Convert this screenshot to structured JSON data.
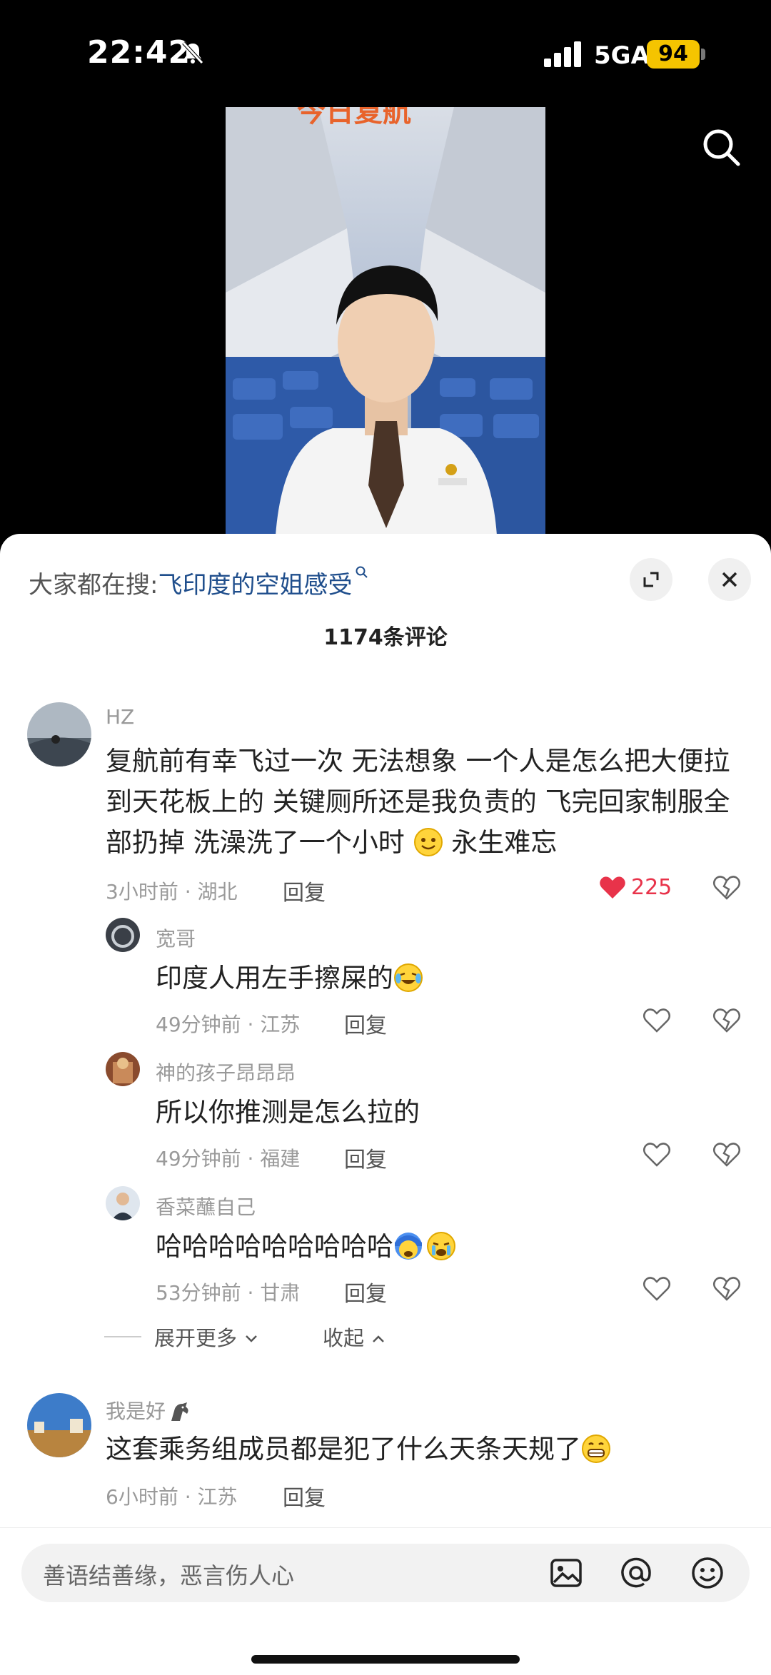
{
  "status_bar": {
    "time": "22:42",
    "network": "5GA",
    "battery": "94"
  },
  "video": {
    "banner_text": "今日复航"
  },
  "sheet": {
    "hot_search_prefix": "大家都在搜:",
    "hot_search_query": "飞印度的空姐感受",
    "comment_count": "1174条评论"
  },
  "comments": [
    {
      "user": "HZ",
      "text": "复航前有幸飞过一次 无法想象 一个人是怎么把大便拉到天花板上的 关键厕所还是我负责的 飞完回家制服全部扔掉 洗澡洗了一个小时",
      "text_tail": " 永生难忘",
      "meta": "3小时前 · 湖北",
      "reply": "回复",
      "likes": "225"
    },
    {
      "user": "宽哥",
      "text": "印度人用左手擦屎的",
      "meta": "49分钟前 · 江苏",
      "reply": "回复"
    },
    {
      "user": "神的孩子昂昂昂",
      "text": "所以你推测是怎么拉的",
      "meta": "49分钟前 · 福建",
      "reply": "回复"
    },
    {
      "user": "香菜蘸自己",
      "text": "哈哈哈哈哈哈哈哈哈",
      "meta": "53分钟前 · 甘肃",
      "reply": "回复"
    },
    {
      "user": "我是好",
      "text": "这套乘务组成员都是犯了什么天条天规了",
      "meta": "6小时前 · 江苏",
      "reply": "回复"
    }
  ],
  "thread_controls": {
    "expand": "展开更多",
    "collapse": "收起"
  },
  "composer": {
    "placeholder": "善语结善缘，恶言伤人心"
  },
  "colors": {
    "like_red": "#e8334a",
    "link_blue": "#1f4e8c",
    "battery_yellow": "#f5c400"
  }
}
